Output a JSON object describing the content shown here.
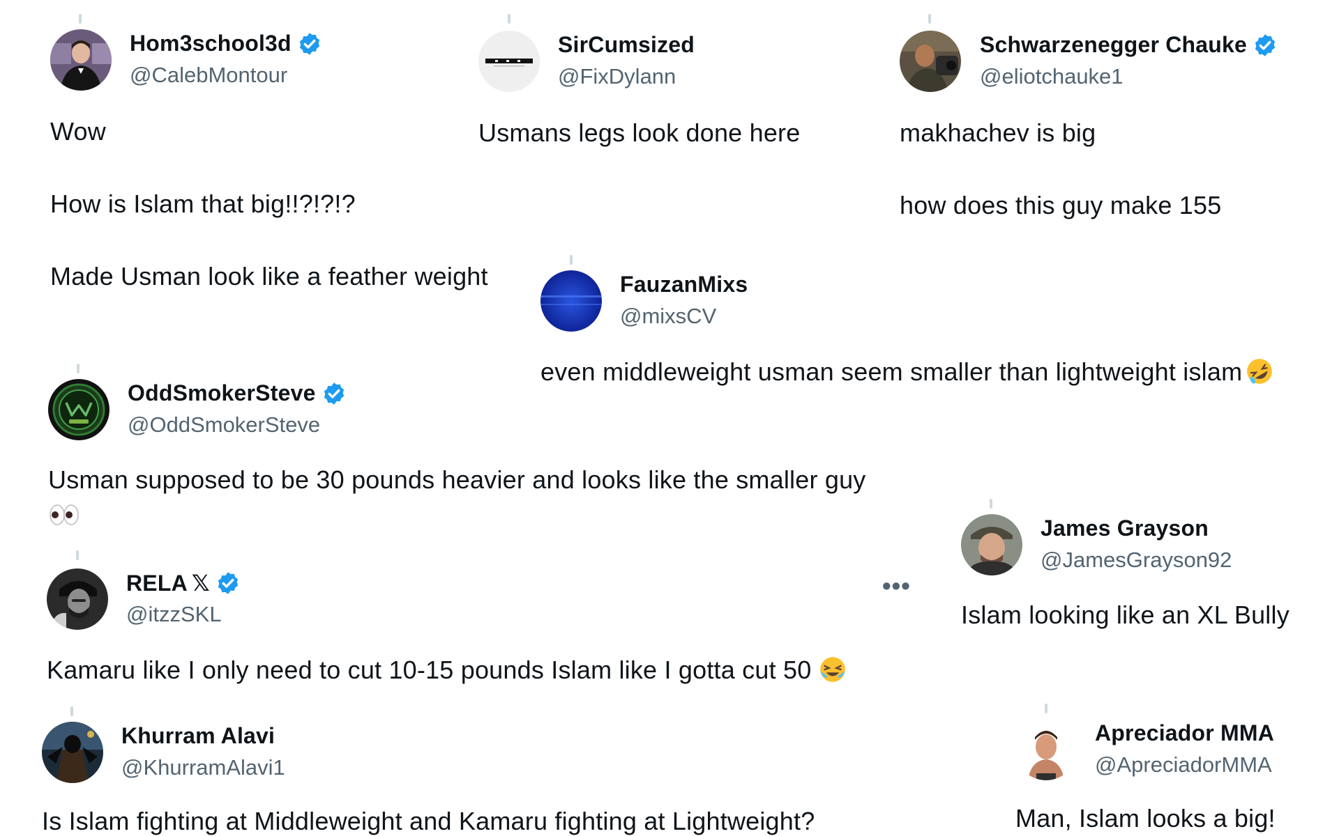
{
  "tweets": {
    "t1": {
      "display_name": "Hom3school3d",
      "handle": "@CalebMontour",
      "verified": true,
      "lines": [
        "Wow",
        "How is Islam that big!!?!?!?",
        "Made Usman look like a feather weight"
      ]
    },
    "t2": {
      "display_name": "SirCumsized",
      "handle": "@FixDylann",
      "verified": false,
      "lines": [
        "Usmans legs look done here"
      ]
    },
    "t3": {
      "display_name": "Schwarzenegger Chauke",
      "handle": "@eliotchauke1",
      "verified": true,
      "lines": [
        "makhachev is big",
        "how does this guy make 155"
      ]
    },
    "t4": {
      "display_name": "FauzanMixs",
      "handle": "@mixsCV",
      "verified": false,
      "lines": [
        "even middleweight usman seem smaller than lightweight islam"
      ],
      "emoji": "rolling-on-floor-laughing-emoji"
    },
    "t5": {
      "display_name": "OddSmokerSteve",
      "handle": "@OddSmokerSteve",
      "verified": true,
      "lines": [
        "Usman supposed to be 30 pounds heavier and looks like the smaller guy"
      ],
      "emoji": "eyes-emoji"
    },
    "t6": {
      "display_name": "RELA",
      "name_suffix": "𝕏",
      "handle": "@itzzSKL",
      "verified": true,
      "lines": [
        "Kamaru  like I only need to cut 10-15 pounds Islam like I gotta cut 50"
      ],
      "emoji": "loudly-crying-laughing-emoji",
      "more_label": "•••"
    },
    "t7": {
      "display_name": "James Grayson",
      "handle": "@JamesGrayson92",
      "verified": false,
      "lines": [
        "Islam looking like an XL Bully"
      ]
    },
    "t8": {
      "display_name": "Khurram Alavi",
      "handle": "@KhurramAlavi1",
      "verified": false,
      "lines": [
        "Is Islam fighting at Middleweight and Kamaru fighting at Lightweight?"
      ]
    },
    "t9": {
      "display_name": "Apreciador MMA",
      "handle": "@ApreciadorMMA",
      "verified": false,
      "lines": [
        "Man, Islam looks a big!"
      ]
    }
  },
  "colors": {
    "text": "#0f1419",
    "handle": "#536471",
    "verified": "#1d9bf0",
    "thread_line": "#cfd9de"
  }
}
